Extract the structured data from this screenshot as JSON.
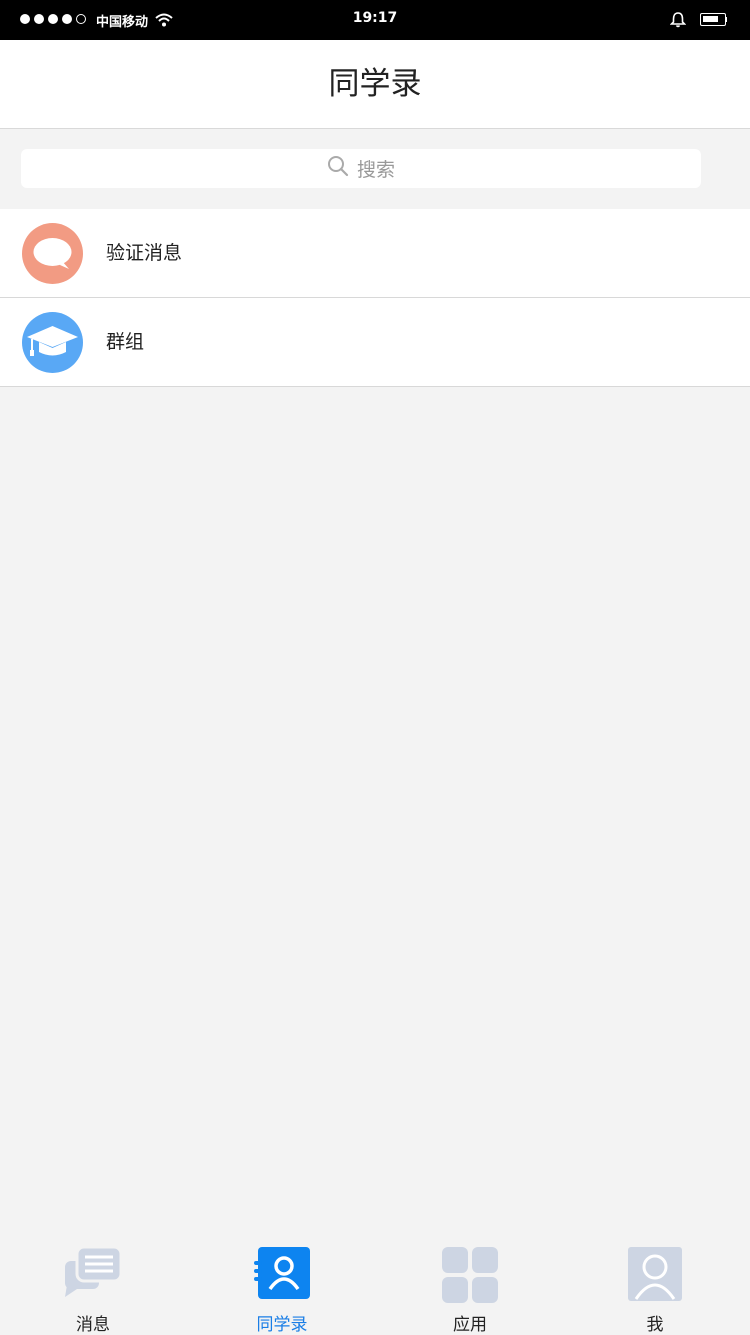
{
  "status_bar": {
    "carrier": "中国移动",
    "time": "19:17"
  },
  "header": {
    "title": "同学录"
  },
  "search": {
    "placeholder": "搜索"
  },
  "list": [
    {
      "label": "验证消息",
      "icon": "chat-bubble-icon",
      "color": "#f29b83"
    },
    {
      "label": "群组",
      "icon": "graduation-cap-icon",
      "color": "#59a8f5"
    }
  ],
  "tabs": [
    {
      "label": "消息",
      "icon": "messages-icon",
      "active": false
    },
    {
      "label": "同学录",
      "icon": "contacts-book-icon",
      "active": true
    },
    {
      "label": "应用",
      "icon": "apps-grid-icon",
      "active": false
    },
    {
      "label": "我",
      "icon": "profile-icon",
      "active": false
    }
  ],
  "colors": {
    "accent": "#1a7ee6",
    "inactive_icon": "#cdd5e3",
    "background": "#f3f3f3"
  }
}
